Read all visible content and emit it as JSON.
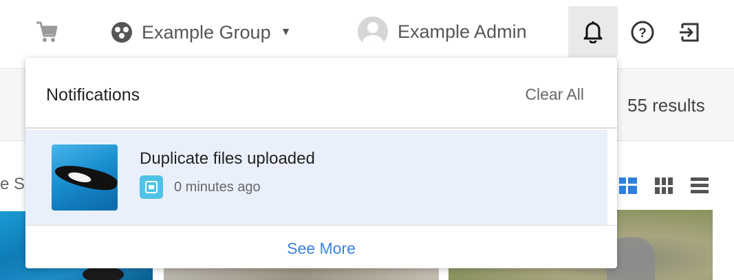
{
  "header": {
    "cart_icon": "cart-icon",
    "group_icon": "group-icon",
    "group_label": "Example Group",
    "user_label": "Example Admin",
    "bell_icon": "bell-icon",
    "help_icon": "help-icon",
    "logout_icon": "logout-icon"
  },
  "background": {
    "results_text": "55 results",
    "partial_text": "e S"
  },
  "notifications": {
    "title": "Notifications",
    "clear_all_label": "Clear All",
    "items": [
      {
        "text": "Duplicate files uploaded",
        "time": "0 minutes ago",
        "type_icon": "image-file-icon"
      }
    ],
    "see_more_label": "See More"
  },
  "colors": {
    "link": "#3b82e0",
    "unread_bg": "#eaf0fb",
    "file_badge": "#4fc3e5",
    "active_view_icon": "#2f7fe0"
  }
}
